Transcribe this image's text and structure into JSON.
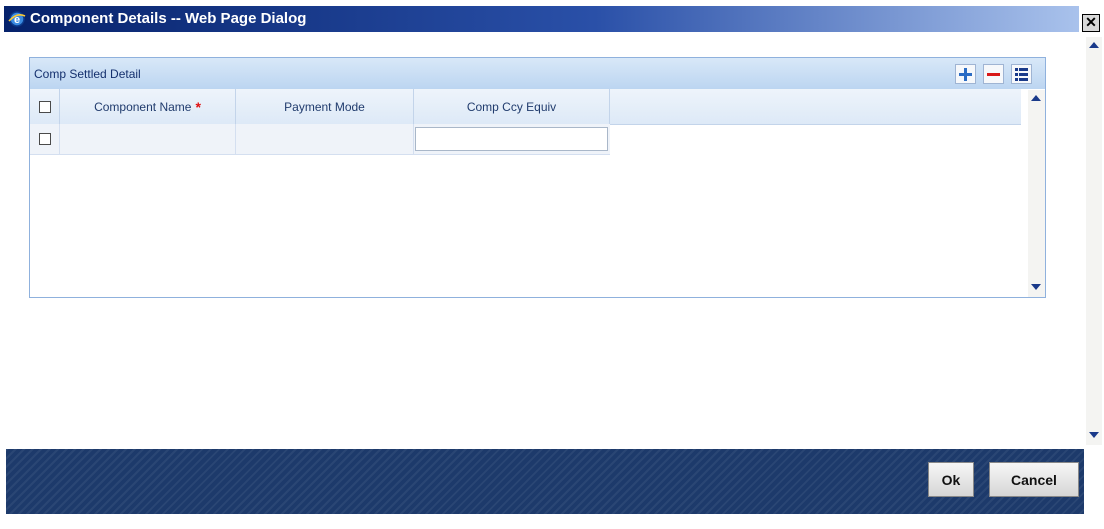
{
  "window": {
    "title": "Component Details -- Web Page Dialog",
    "close_glyph": "✕"
  },
  "panel": {
    "title": "Comp Settled Detail",
    "tools": [
      "add-icon",
      "remove-icon",
      "view-list-icon"
    ]
  },
  "grid": {
    "headers": {
      "component_name": "Component Name",
      "required_mark": "*",
      "payment_mode": "Payment Mode",
      "comp_ccy_equiv": "Comp Ccy Equiv"
    },
    "rows": [
      {
        "component_name": "",
        "payment_mode": "",
        "comp_ccy_equiv": ""
      }
    ]
  },
  "footer": {
    "ok_label": "Ok",
    "cancel_label": "Cancel"
  },
  "colors": {
    "title_start": "#06226b",
    "footer_bg": "#1d3a6b",
    "required": "#e01010",
    "panel_header": "#bcd5f1"
  }
}
